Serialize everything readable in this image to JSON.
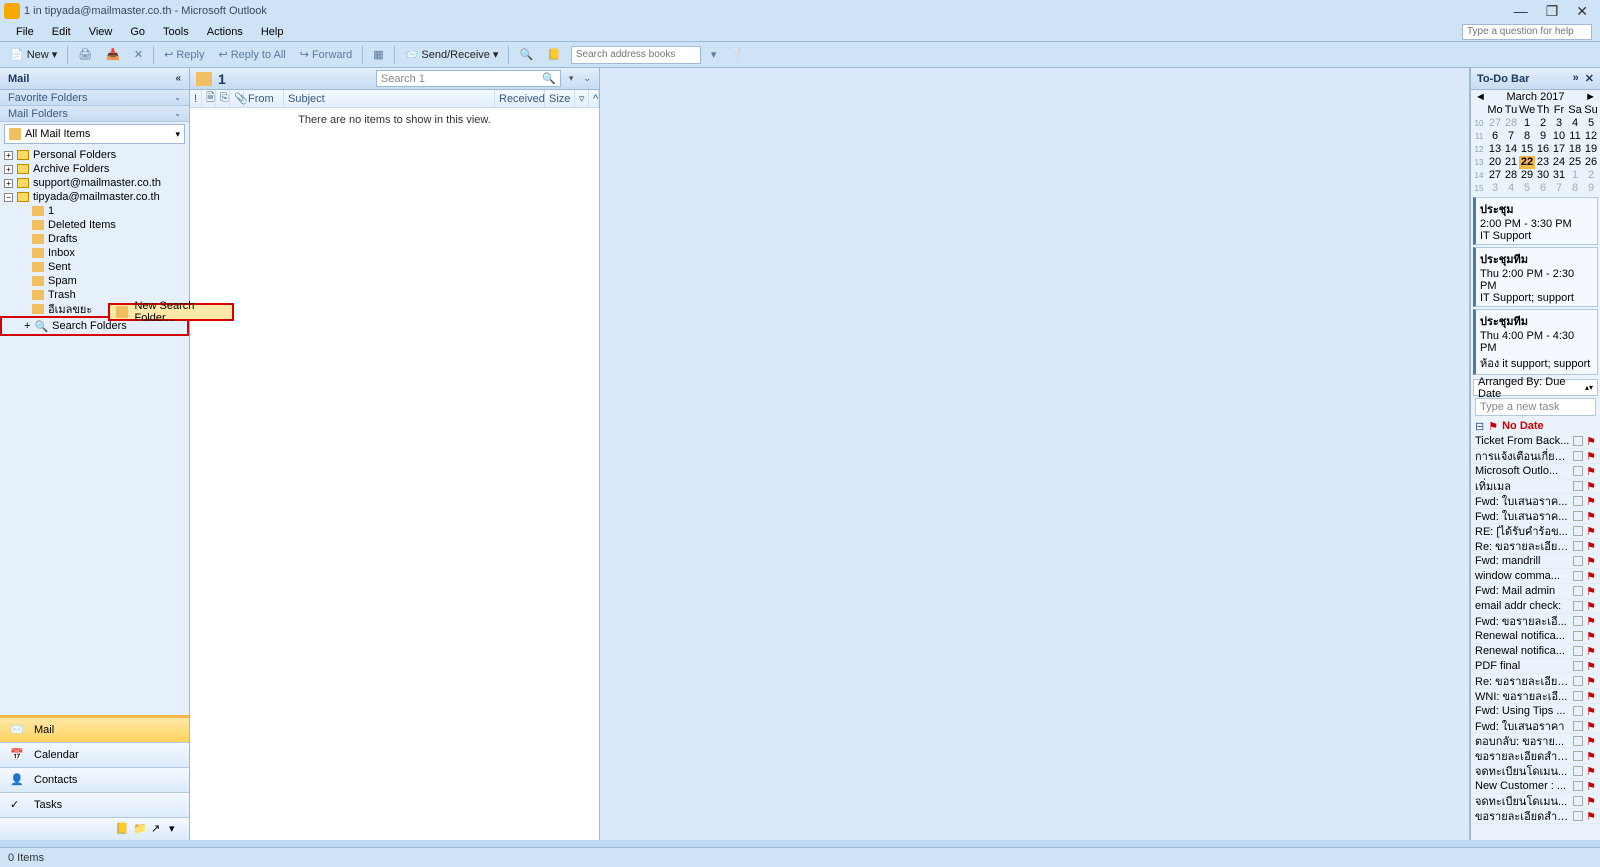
{
  "title": "1 in tipyada@mailmaster.co.th - Microsoft Outlook",
  "menu": [
    "File",
    "Edit",
    "View",
    "Go",
    "Tools",
    "Actions",
    "Help"
  ],
  "helpbox_ph": "Type a question for help",
  "toolbar": {
    "new": "New",
    "reply": "Reply",
    "replyall": "Reply to All",
    "forward": "Forward",
    "sendrecv": "Send/Receive",
    "search_ph": "Search address books"
  },
  "nav": {
    "title": "Mail",
    "fav": "Favorite Folders",
    "mf": "Mail Folders",
    "all": "All Mail Items",
    "roots": [
      "Personal Folders",
      "Archive Folders",
      "support@mailmaster.co.th",
      "tipyada@mailmaster.co.th"
    ],
    "subs": [
      "1",
      "Deleted Items",
      "Drafts",
      "Inbox",
      "Sent",
      "Spam",
      "Trash",
      "อีเมลขยะ"
    ],
    "searchfolders": "Search Folders",
    "ctx": "New Search Folder...",
    "btns": [
      "Mail",
      "Calendar",
      "Contacts",
      "Tasks"
    ]
  },
  "list": {
    "folder": "1",
    "search_ph": "Search 1",
    "cols": {
      "from": "From",
      "subject": "Subject",
      "received": "Received",
      "size": "Size"
    },
    "empty": "There are no items to show in this view."
  },
  "todo": {
    "title": "To-Do Bar",
    "month": "March 2017",
    "dow": [
      "Mo",
      "Tu",
      "We",
      "Th",
      "Fr",
      "Sa",
      "Su"
    ],
    "weeks": [
      {
        "n": "10",
        "d": [
          "27",
          "28",
          "1",
          "2",
          "3",
          "4",
          "5"
        ],
        "dim": [
          0,
          1
        ]
      },
      {
        "n": "11",
        "d": [
          "6",
          "7",
          "8",
          "9",
          "10",
          "11",
          "12"
        ],
        "dim": []
      },
      {
        "n": "12",
        "d": [
          "13",
          "14",
          "15",
          "16",
          "17",
          "18",
          "19"
        ],
        "dim": []
      },
      {
        "n": "13",
        "d": [
          "20",
          "21",
          "22",
          "23",
          "24",
          "25",
          "26"
        ],
        "dim": [],
        "today": 2
      },
      {
        "n": "14",
        "d": [
          "27",
          "28",
          "29",
          "30",
          "31",
          "1",
          "2"
        ],
        "dim": [
          5,
          6
        ]
      },
      {
        "n": "15",
        "d": [
          "3",
          "4",
          "5",
          "6",
          "7",
          "8",
          "9"
        ],
        "dim": [
          0,
          1,
          2,
          3,
          4,
          5,
          6
        ]
      }
    ],
    "appts": [
      {
        "t": "ประชุม",
        "time": "2:00 PM - 3:30 PM",
        "loc": "IT Support"
      },
      {
        "t": "ประชุมทีม",
        "time": "Thu 2:00 PM - 2:30 PM",
        "loc": "IT Support; support"
      },
      {
        "t": "ประชุมทีม",
        "time": "Thu 4:00 PM - 4:30 PM",
        "loc": "ห้อง it support; support"
      }
    ],
    "arranged": "Arranged By: Due Date",
    "newtask_ph": "Type a new task",
    "nodate": "No Date",
    "tasks": [
      "Ticket From Back...",
      "การแจ้งเตือนเกี่ยวก...",
      "Microsoft Outlo...",
      "เทิ่มเมล",
      "Fwd: ใบเสนอราค...",
      "Fwd: ใบเสนอราค...",
      "RE: [ได้รับคำร้อข...",
      "Re: ขอรายละเอียด...",
      "Fwd: mandrill",
      "window comma...",
      "Fwd: Mail admin",
      "email addr check:",
      "Fwd: ขอรายละเอี...",
      "Renewal notifica...",
      "Renewal notifica...",
      "PDF final",
      "Re: ขอรายละเอียด...",
      "WNI: ขอรายละเอี...",
      "Fwd: Using Tips ...",
      "Fwd: ใบเสนอราคา",
      "ตอบกลับ: ขอราย...",
      "ขอรายละเอียดสำห...",
      "จดทะเบียนโดเมน...",
      "New Customer : ...",
      "จดทะเบียนโดเมน...",
      "ขอรายละเอียดสำห..."
    ]
  },
  "status": "0 Items"
}
